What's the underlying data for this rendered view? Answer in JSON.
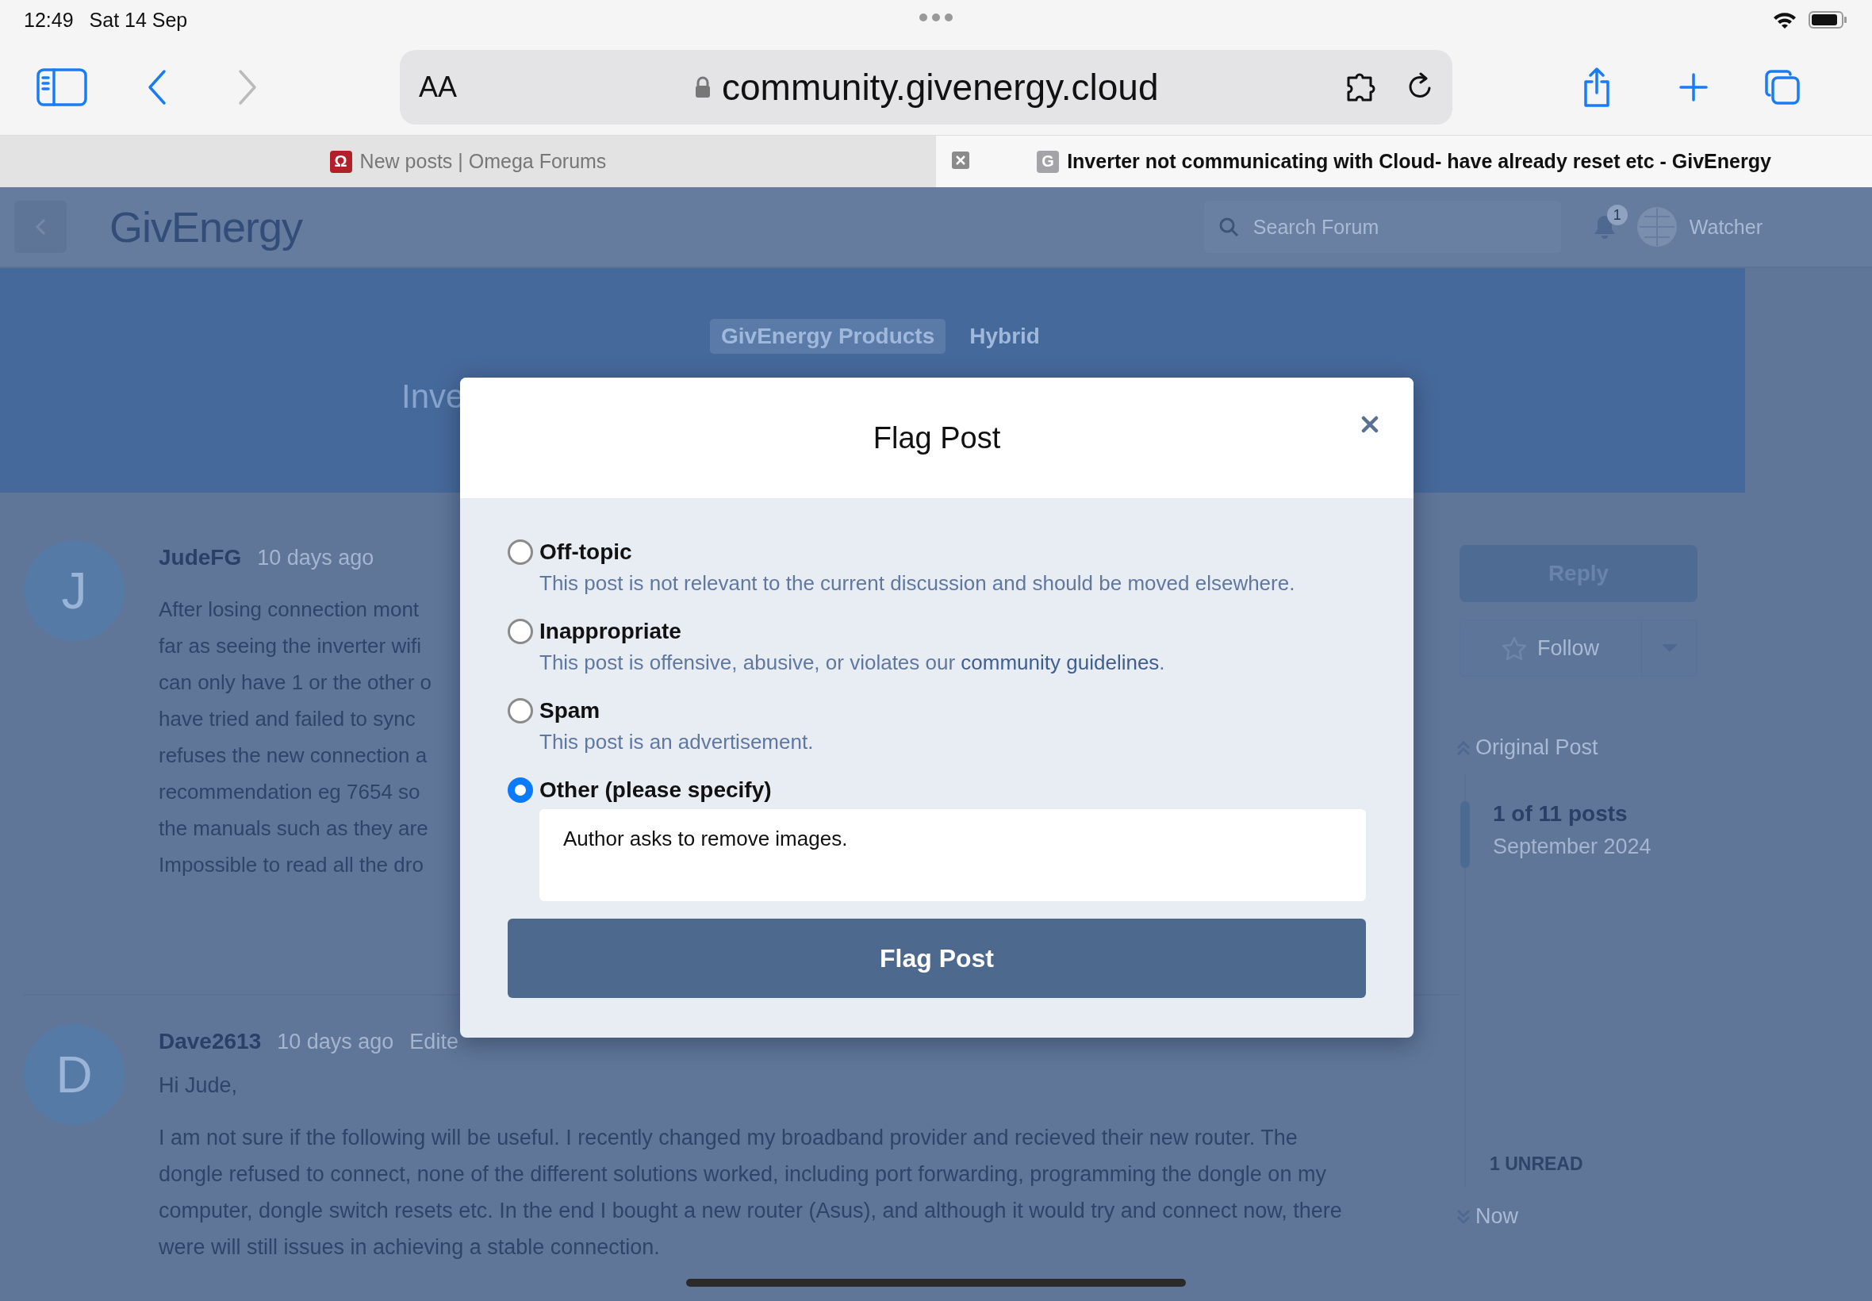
{
  "status_bar": {
    "time": "12:49",
    "date": "Sat 14 Sep"
  },
  "browser": {
    "reader_button": "AA",
    "url": "community.givenergy.cloud"
  },
  "tabs": [
    {
      "favicon_letter": "Ω",
      "title": "New posts | Omega Forums",
      "selected": false
    },
    {
      "favicon_letter": "G",
      "title": "Inverter not communicating with Cloud- have already reset etc - GivEnergy",
      "selected": true
    }
  ],
  "forum_header": {
    "logo": "GivEnergy",
    "search": {
      "placeholder": "Search Forum"
    },
    "notification_count": "1",
    "username": "Watcher"
  },
  "topic": {
    "tags": [
      {
        "label": "GivEnergy Products",
        "kind": "chip"
      },
      {
        "label": "Hybrid",
        "kind": "plain"
      }
    ],
    "title": "Inve"
  },
  "posts": [
    {
      "avatar_letter": "J",
      "author": "JudeFG",
      "meta": [
        "10 days ago"
      ],
      "lines": [
        "After losing connection mont",
        "far as seeing the inverter wifi",
        "can only have 1 or the other o",
        "have tried and failed to sync",
        "refuses the new connection a",
        "recommendation eg 7654 so",
        "the manuals such as they are",
        "Impossible to read all the dro"
      ]
    },
    {
      "avatar_letter": "D",
      "author": "Dave2613",
      "meta": [
        "10 days ago",
        "Edite"
      ],
      "paragraphs": [
        "Hi Jude,",
        "I am not sure if the following will be useful. I recently changed my broadband provider and recieved their new router. The dongle refused to connect, none of the different solutions worked, including port forwarding, programming the dongle on my computer, dongle switch resets etc. In the end I bought a new router (Asus), and although it would try and connect now, there were will still issues in achieving a stable connection."
      ]
    }
  ],
  "sidebar": {
    "reply": "Reply",
    "follow": "Follow",
    "original_post": "Original Post",
    "position": "1 of 11 posts",
    "date": "September 2024",
    "unread": "1 UNREAD",
    "now": "Now"
  },
  "dialog": {
    "title": "Flag Post",
    "options": [
      {
        "label": "Off-topic",
        "description": "This post is not relevant to the current discussion and should be moved elsewhere.",
        "selected": false
      },
      {
        "label": "Inappropriate",
        "description": "This post is offensive, abusive, or violates our ",
        "link": "community guidelines",
        "description_end": ".",
        "selected": false
      },
      {
        "label": "Spam",
        "description": "This post is an advertisement.",
        "selected": false
      },
      {
        "label": "Other (please specify)",
        "selected": true
      }
    ],
    "note": {
      "value": "Author asks to remove images."
    },
    "submit": "Flag Post"
  }
}
